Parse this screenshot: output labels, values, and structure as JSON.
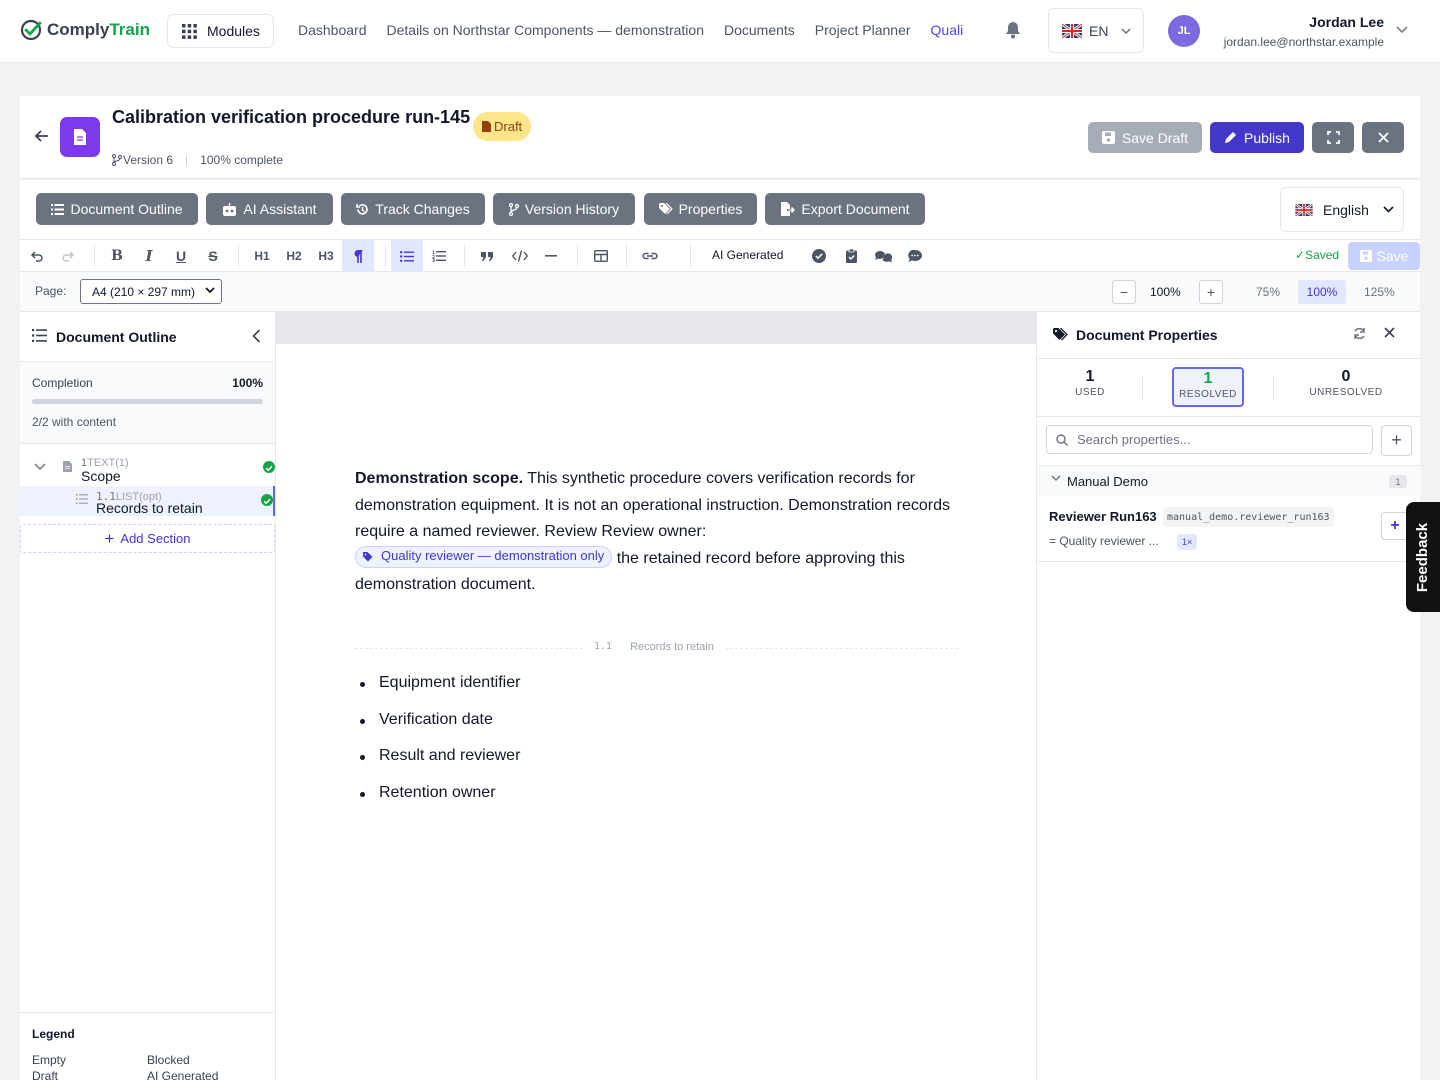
{
  "brand": {
    "name_part1": "Comply",
    "name_part2": "Train"
  },
  "nav": {
    "modules": "Modules",
    "links": [
      "Dashboard",
      "Details on Northstar Components — demonstration",
      "Documents",
      "Project Planner",
      "Quali"
    ],
    "lang": "EN"
  },
  "user": {
    "initials": "JL",
    "name": "Jordan Lee",
    "email": "jordan.lee@northstar.example"
  },
  "document": {
    "title": "Calibration verification procedure run-145",
    "status": "Draft",
    "version": "Version 6",
    "progress": "100% complete",
    "save_draft": "Save Draft",
    "publish": "Publish"
  },
  "tabs": [
    "Document Outline",
    "AI Assistant",
    "Track Changes",
    "Version History",
    "Properties",
    "Export Document"
  ],
  "language": "English",
  "toolbar": {
    "headings": [
      "H1",
      "H2",
      "H3"
    ],
    "ai_generated": "AI Generated",
    "saved_label": "Saved",
    "save_label": "Save"
  },
  "pagebar": {
    "page_label": "Page:",
    "page_size": "A4 (210 × 297 mm)",
    "zoom": "100%",
    "zoom_options": [
      "75%",
      "100%",
      "125%"
    ],
    "zoom_selected": "100%"
  },
  "outline": {
    "title": "Document Outline",
    "completion_label": "Completion",
    "completion_value": "100%",
    "completion_fraction": 1.0,
    "with_content": "2/2 with content",
    "sections": [
      {
        "number": "1",
        "type": "TEXT(1)",
        "title": "Scope",
        "status": "complete"
      },
      {
        "number": "1.1",
        "type": "LIST(opt)",
        "title": "Records to retain",
        "status": "complete"
      }
    ],
    "add_section": "Add Section",
    "legend_title": "Legend",
    "legend_items": [
      "Empty",
      "Blocked",
      "Draft",
      "AI Generated"
    ]
  },
  "content": {
    "lead_bold": "Demonstration scope.",
    "lead_text": " This synthetic procedure covers verification records for demonstration equipment. It is not an operational instruction. Demonstration records require a named reviewer. Review Review owner:",
    "chip": "Quality reviewer — demonstration only",
    "tail_text": " the retained record before approving this demonstration document.",
    "subsection_number": "1.1",
    "subsection_title": "Records to retain",
    "bullets": [
      "Equipment identifier",
      "Verification date",
      "Result and reviewer",
      "Retention owner"
    ]
  },
  "properties": {
    "title": "Document Properties",
    "stats": [
      {
        "value": "1",
        "label": "USED"
      },
      {
        "value": "1",
        "label": "RESOLVED"
      },
      {
        "value": "0",
        "label": "UNRESOLVED"
      }
    ],
    "search_placeholder": "Search properties...",
    "group": "Manual Demo",
    "group_count": "1",
    "item": {
      "name": "Reviewer Run163",
      "key": "manual_demo.reviewer_run163",
      "value": "= Quality reviewer ...",
      "uses": "1×"
    }
  },
  "feedback": "Feedback",
  "colors": {
    "accent": "#4338ca",
    "success": "#16a34a",
    "draft_bg": "#fde68a",
    "doc_icon": "#7c3aed"
  }
}
